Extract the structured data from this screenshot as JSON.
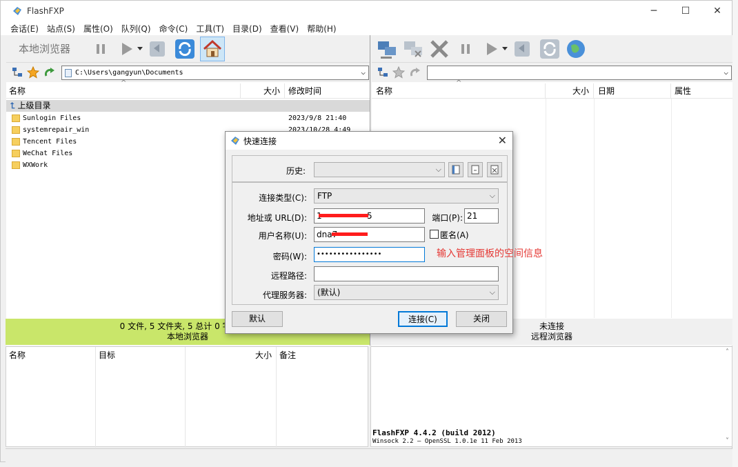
{
  "app": {
    "title": "FlashFXP"
  },
  "menu": [
    "会话(E)",
    "站点(S)",
    "属性(O)",
    "队列(Q)",
    "命令(C)",
    "工具(T)",
    "目录(D)",
    "查看(V)",
    "帮助(H)"
  ],
  "local": {
    "toolbar_label": "本地浏览器",
    "path": "C:\\Users\\gangyun\\Documents",
    "columns": {
      "name": "名称",
      "size": "大小",
      "modified": "修改时间"
    },
    "parent_dir": "上级目录",
    "files": [
      {
        "name": "Sunlogin Files",
        "modified": "2023/9/8 21:40"
      },
      {
        "name": "systemrepair_win",
        "modified": "2023/10/28 4:49"
      },
      {
        "name": "Tencent Files",
        "modified": ""
      },
      {
        "name": "WeChat Files",
        "modified": ""
      },
      {
        "name": "WXWork",
        "modified": ""
      }
    ],
    "status_line1": "0 文件, 5 文件夹, 5 总计 0 字节 (14",
    "status_line2": "本地浏览器"
  },
  "remote": {
    "columns": {
      "name": "名称",
      "size": "大小",
      "date": "日期",
      "attr": "属性"
    },
    "status_line1": "未连接",
    "status_line2": "远程浏览器"
  },
  "queue": {
    "columns": {
      "name": "名称",
      "target": "目标",
      "size": "大小",
      "note": "备注"
    }
  },
  "log": {
    "line1": "FlashFXP 4.4.2 (build 2012)",
    "line2": "Winsock 2.2 — OpenSSL 1.0.1e 11 Feb 2013"
  },
  "dialog": {
    "title": "快速连接",
    "history_label": "历史:",
    "conn_type_label": "连接类型(C):",
    "conn_type_value": "FTP",
    "address_label": "地址或 URL(D):",
    "address_value_start": "1",
    "address_value_end": "5",
    "port_label": "端口(P):",
    "port_value": "21",
    "user_label": "用户名称(U):",
    "user_value": "dna7",
    "anon_label": "匿名(A)",
    "password_label": "密码(W):",
    "password_value": "••••••••••••••••",
    "remote_path_label": "远程路径:",
    "proxy_label": "代理服务器:",
    "proxy_value": "(默认)",
    "default_button": "默认",
    "connect_button": "连接(C)",
    "close_button": "关闭"
  },
  "annotation": "输入管理面板的空间信息"
}
